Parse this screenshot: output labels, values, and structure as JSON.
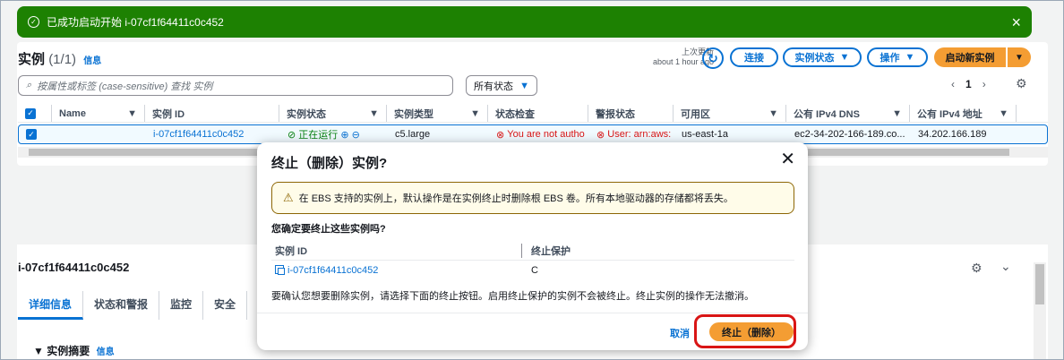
{
  "flash": {
    "message": "已成功启动开始 i-07cf1f64411c0c452"
  },
  "instances": {
    "title": "实例",
    "count": "(1/1)",
    "info_link": "信息",
    "last_updated_label": "上次更新",
    "last_updated_value": "about 1 hour ago",
    "connect_label": "连接",
    "instance_state_label": "实例状态",
    "actions_label": "操作",
    "launch_label": "启动新实例",
    "search_placeholder": "按属性或标签 (case-sensitive) 查找 实例",
    "state_filter": "所有状态",
    "page": "1",
    "columns": [
      "Name",
      "实例 ID",
      "实例状态",
      "实例类型",
      "状态检查",
      "警报状态",
      "可用区",
      "公有 IPv4 DNS",
      "公有 IPv4 地址"
    ],
    "row": {
      "instance_id": "i-07cf1f64411c0c452",
      "state": "正在运行",
      "type": "c5.large",
      "status_check": "You are not autho",
      "alarm": "User: arn:aws:",
      "az": "us-east-1a",
      "dns": "ec2-34-202-166-189.co...",
      "ip": "34.202.166.189"
    }
  },
  "detail": {
    "title": "i-07cf1f64411c0c452",
    "tabs": [
      "详细信息",
      "状态和警报",
      "监控",
      "安全"
    ],
    "summary": "实例摘要",
    "summary_info": "信息"
  },
  "modal": {
    "title": "终止（删除）实例?",
    "warning": "在 EBS 支持的实例上，默认操作是在实例终止时删除根 EBS 卷。所有本地驱动器的存储都将丢失。",
    "question": "您确定要终止这些实例吗?",
    "col_id": "实例 ID",
    "col_protect": "终止保护",
    "row_id": "i-07cf1f64411c0c452",
    "row_protect": "C",
    "note": "要确认您想要删除实例，请选择下面的终止按钮。启用终止保护的实例不会被终止。终止实例的操作无法撤消。",
    "cancel": "取消",
    "confirm": "终止（删除）"
  }
}
